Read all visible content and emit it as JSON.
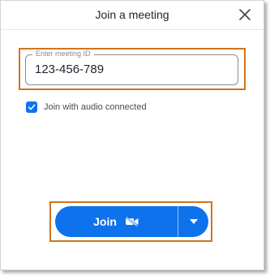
{
  "window": {
    "title": "Join a meeting",
    "close_icon": "close-icon"
  },
  "meeting_id": {
    "label": "Enter meeting ID",
    "value": "123-456-789"
  },
  "audio_option": {
    "label": "Join with audio connected",
    "checked": true
  },
  "join": {
    "label": "Join",
    "camera_icon": "video-off-icon",
    "dropdown_icon": "caret-down-icon"
  },
  "colors": {
    "accent": "#0e72ed",
    "highlight": "#d0741d",
    "text": "#232333"
  }
}
